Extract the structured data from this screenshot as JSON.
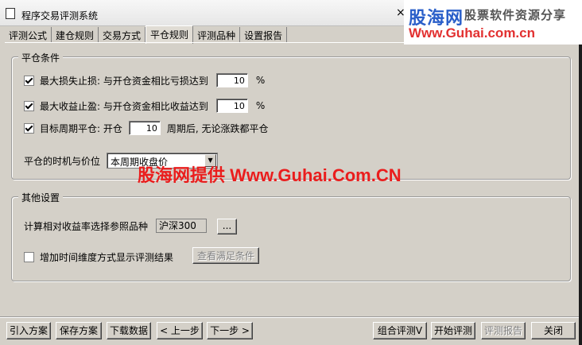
{
  "window": {
    "title": "程序交易评测系统",
    "close_symbol": "×"
  },
  "watermark": {
    "logo_name": "股海网",
    "logo_tag": "股票软件资源分享",
    "logo_url": "Www.Guhai.com.cn",
    "overlay": "股海网提供 Www.Guhai.Com.CN"
  },
  "tabs": [
    {
      "label": "评测公式"
    },
    {
      "label": "建仓规则"
    },
    {
      "label": "交易方式"
    },
    {
      "label": "平仓规则",
      "active": true
    },
    {
      "label": "评测品种"
    },
    {
      "label": "设置报告"
    }
  ],
  "close_conditions": {
    "legend": "平仓条件",
    "max_loss": {
      "checked": true,
      "label": "最大损失止损: 与开仓资金相比亏损达到",
      "value": "10",
      "unit": "%"
    },
    "max_profit": {
      "checked": true,
      "label": "最大收益止盈: 与开仓资金相比收益达到",
      "value": "10",
      "unit": "%"
    },
    "target_period": {
      "checked": true,
      "label_before": "目标周期平仓: 开仓",
      "value": "10",
      "label_after": "周期后, 无论涨跌都平仓"
    },
    "timing": {
      "label": "平仓的时机与价位",
      "selected": "本周期收盘价"
    }
  },
  "other_settings": {
    "legend": "其他设置",
    "reference": {
      "label": "计算相对收益率选择参照品种",
      "value": "沪深300",
      "browse_label": "..."
    },
    "time_dimension": {
      "checked": false,
      "label": "增加时间维度方式显示评测结果",
      "view_button": "查看满足条件"
    }
  },
  "footer": {
    "import": "引入方案",
    "save": "保存方案",
    "download": "下载数据",
    "prev": "< 上一步",
    "next": "下一步 >",
    "combine": "组合评测V",
    "start": "开始评测",
    "report": "评测报告",
    "close": "关闭"
  }
}
